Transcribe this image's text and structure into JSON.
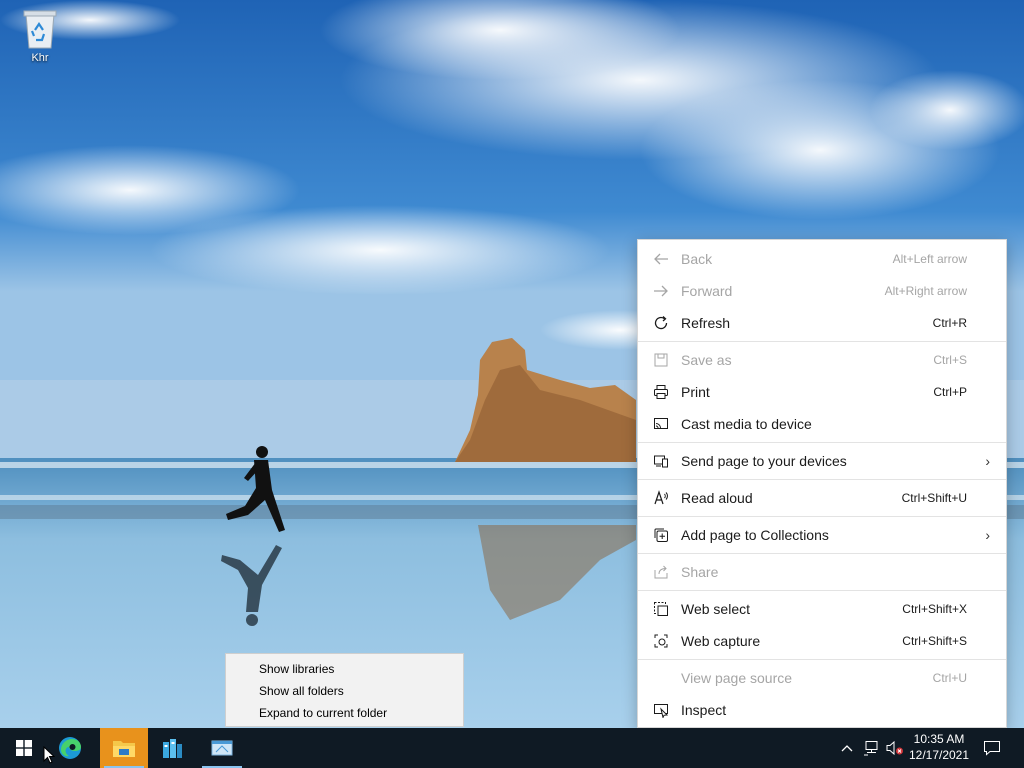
{
  "desktop": {
    "recycle_bin_label": "Khr"
  },
  "explorer_menu": {
    "items": [
      "Show libraries",
      "Show all folders",
      "Expand to current folder"
    ]
  },
  "context_menu": {
    "back": {
      "label": "Back",
      "shortcut": "Alt+Left arrow",
      "icon": "back-arrow-icon",
      "enabled": false
    },
    "forward": {
      "label": "Forward",
      "shortcut": "Alt+Right arrow",
      "icon": "forward-arrow-icon",
      "enabled": false
    },
    "refresh": {
      "label": "Refresh",
      "shortcut": "Ctrl+R",
      "icon": "refresh-icon",
      "enabled": true
    },
    "save_as": {
      "label": "Save as",
      "shortcut": "Ctrl+S",
      "icon": "save-icon",
      "enabled": false
    },
    "print": {
      "label": "Print",
      "shortcut": "Ctrl+P",
      "icon": "printer-icon",
      "enabled": true
    },
    "cast": {
      "label": "Cast media to device",
      "shortcut": "",
      "icon": "cast-icon",
      "enabled": true
    },
    "send_page": {
      "label": "Send page to your devices",
      "shortcut": "",
      "icon": "devices-icon",
      "submenu": true
    },
    "read_aloud": {
      "label": "Read aloud",
      "shortcut": "Ctrl+Shift+U",
      "icon": "read-aloud-icon",
      "enabled": true
    },
    "collections": {
      "label": "Add page to Collections",
      "shortcut": "",
      "icon": "collections-icon",
      "submenu": true
    },
    "share": {
      "label": "Share",
      "shortcut": "",
      "icon": "share-icon",
      "enabled": false
    },
    "web_select": {
      "label": "Web select",
      "shortcut": "Ctrl+Shift+X",
      "icon": "web-select-icon",
      "enabled": true
    },
    "web_capture": {
      "label": "Web capture",
      "shortcut": "Ctrl+Shift+S",
      "icon": "web-capture-icon",
      "enabled": true
    },
    "view_source": {
      "label": "View page source",
      "shortcut": "Ctrl+U",
      "enabled": false
    },
    "inspect": {
      "label": "Inspect",
      "shortcut": "",
      "icon": "inspect-icon",
      "enabled": true
    }
  },
  "taskbar": {
    "clock_time": "10:35 AM",
    "clock_date": "12/17/2021",
    "accent_color": "#e8921c",
    "background_color": "#0f1a24"
  }
}
